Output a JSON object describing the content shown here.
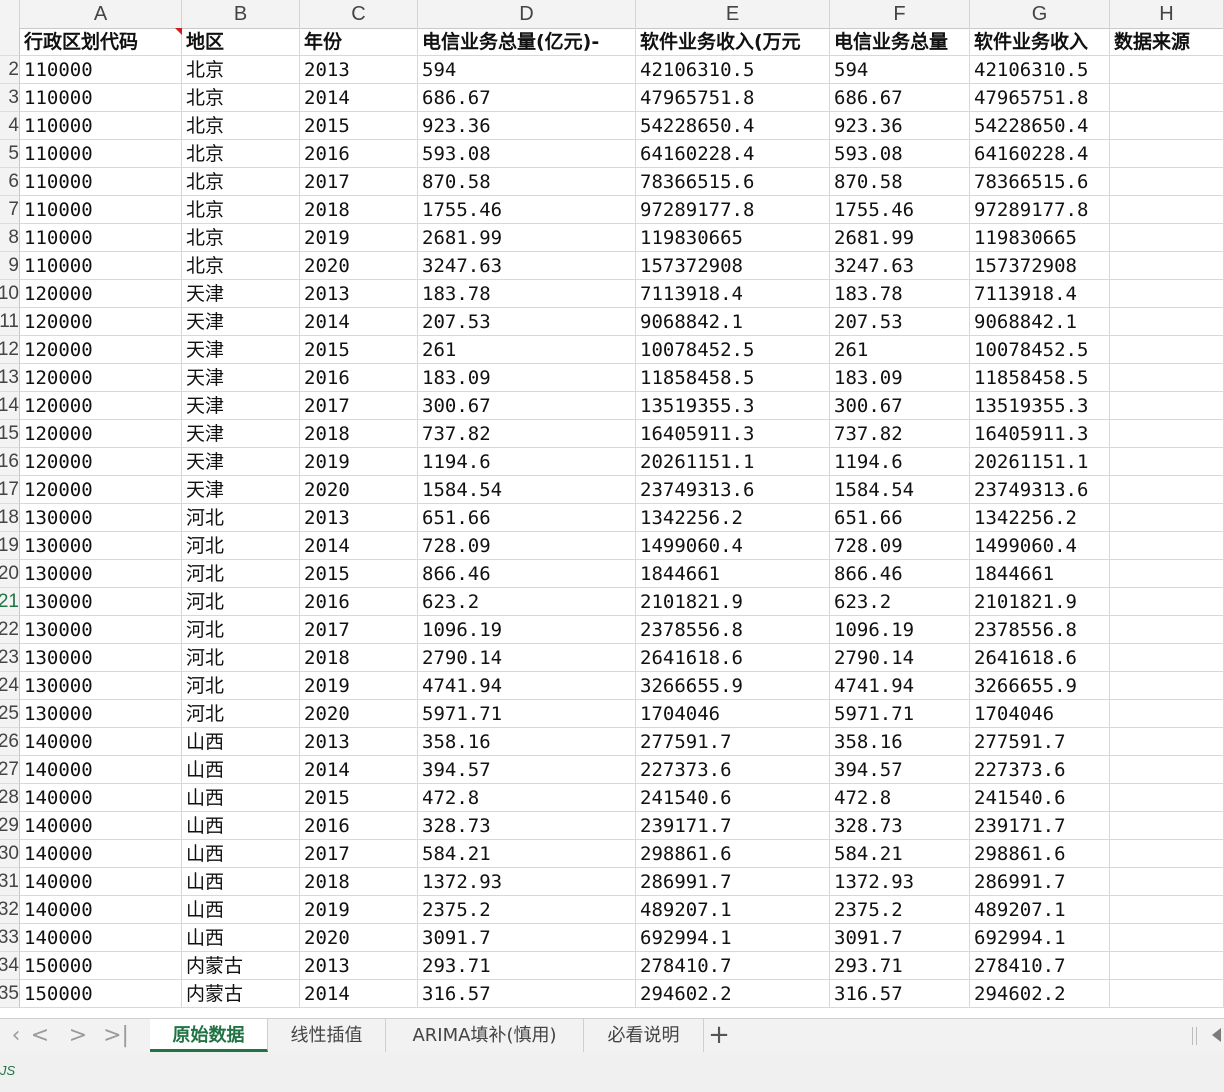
{
  "columns": [
    "A",
    "B",
    "C",
    "D",
    "E",
    "F",
    "G",
    "H"
  ],
  "header": [
    "行政区划代码",
    "地区",
    "年份",
    "电信业务总量(亿元)-",
    "软件业务收入(万元",
    "电信业务总量",
    "软件业务收入",
    "数据来源"
  ],
  "row_numbers": [
    "2",
    "3",
    "4",
    "5",
    "6",
    "7",
    "8",
    "9",
    "10",
    "11",
    "12",
    "13",
    "14",
    "15",
    "16",
    "17",
    "18",
    "19",
    "20",
    "21",
    "22",
    "23",
    "24",
    "25",
    "26",
    "27",
    "28",
    "29",
    "30",
    "31",
    "32",
    "33",
    "34",
    "35"
  ],
  "rows": [
    [
      "110000",
      "北京",
      "2013",
      "594",
      "42106310.5",
      "594",
      "42106310.5",
      ""
    ],
    [
      "110000",
      "北京",
      "2014",
      "686.67",
      "47965751.8",
      "686.67",
      "47965751.8",
      ""
    ],
    [
      "110000",
      "北京",
      "2015",
      "923.36",
      "54228650.4",
      "923.36",
      "54228650.4",
      ""
    ],
    [
      "110000",
      "北京",
      "2016",
      "593.08",
      "64160228.4",
      "593.08",
      "64160228.4",
      ""
    ],
    [
      "110000",
      "北京",
      "2017",
      "870.58",
      "78366515.6",
      "870.58",
      "78366515.6",
      ""
    ],
    [
      "110000",
      "北京",
      "2018",
      "1755.46",
      "97289177.8",
      "1755.46",
      "97289177.8",
      ""
    ],
    [
      "110000",
      "北京",
      "2019",
      "2681.99",
      "119830665",
      "2681.99",
      "119830665",
      ""
    ],
    [
      "110000",
      "北京",
      "2020",
      "3247.63",
      "157372908",
      "3247.63",
      "157372908",
      ""
    ],
    [
      "120000",
      "天津",
      "2013",
      "183.78",
      "7113918.4",
      "183.78",
      "7113918.4",
      ""
    ],
    [
      "120000",
      "天津",
      "2014",
      "207.53",
      "9068842.1",
      "207.53",
      "9068842.1",
      ""
    ],
    [
      "120000",
      "天津",
      "2015",
      "261",
      "10078452.5",
      "261",
      "10078452.5",
      ""
    ],
    [
      "120000",
      "天津",
      "2016",
      "183.09",
      "11858458.5",
      "183.09",
      "11858458.5",
      ""
    ],
    [
      "120000",
      "天津",
      "2017",
      "300.67",
      "13519355.3",
      "300.67",
      "13519355.3",
      ""
    ],
    [
      "120000",
      "天津",
      "2018",
      "737.82",
      "16405911.3",
      "737.82",
      "16405911.3",
      ""
    ],
    [
      "120000",
      "天津",
      "2019",
      "1194.6",
      "20261151.1",
      "1194.6",
      "20261151.1",
      ""
    ],
    [
      "120000",
      "天津",
      "2020",
      "1584.54",
      "23749313.6",
      "1584.54",
      "23749313.6",
      ""
    ],
    [
      "130000",
      "河北",
      "2013",
      "651.66",
      "1342256.2",
      "651.66",
      "1342256.2",
      ""
    ],
    [
      "130000",
      "河北",
      "2014",
      "728.09",
      "1499060.4",
      "728.09",
      "1499060.4",
      ""
    ],
    [
      "130000",
      "河北",
      "2015",
      "866.46",
      "1844661",
      "866.46",
      "1844661",
      ""
    ],
    [
      "130000",
      "河北",
      "2016",
      "623.2",
      "2101821.9",
      "623.2",
      "2101821.9",
      ""
    ],
    [
      "130000",
      "河北",
      "2017",
      "1096.19",
      "2378556.8",
      "1096.19",
      "2378556.8",
      ""
    ],
    [
      "130000",
      "河北",
      "2018",
      "2790.14",
      "2641618.6",
      "2790.14",
      "2641618.6",
      ""
    ],
    [
      "130000",
      "河北",
      "2019",
      "4741.94",
      "3266655.9",
      "4741.94",
      "3266655.9",
      ""
    ],
    [
      "130000",
      "河北",
      "2020",
      "5971.71",
      "1704046",
      "5971.71",
      "1704046",
      ""
    ],
    [
      "140000",
      "山西",
      "2013",
      "358.16",
      "277591.7",
      "358.16",
      "277591.7",
      ""
    ],
    [
      "140000",
      "山西",
      "2014",
      "394.57",
      "227373.6",
      "394.57",
      "227373.6",
      ""
    ],
    [
      "140000",
      "山西",
      "2015",
      "472.8",
      "241540.6",
      "472.8",
      "241540.6",
      ""
    ],
    [
      "140000",
      "山西",
      "2016",
      "328.73",
      "239171.7",
      "328.73",
      "239171.7",
      ""
    ],
    [
      "140000",
      "山西",
      "2017",
      "584.21",
      "298861.6",
      "584.21",
      "298861.6",
      ""
    ],
    [
      "140000",
      "山西",
      "2018",
      "1372.93",
      "286991.7",
      "1372.93",
      "286991.7",
      ""
    ],
    [
      "140000",
      "山西",
      "2019",
      "2375.2",
      "489207.1",
      "2375.2",
      "489207.1",
      ""
    ],
    [
      "140000",
      "山西",
      "2020",
      "3091.7",
      "692994.1",
      "3091.7",
      "692994.1",
      ""
    ],
    [
      "150000",
      "内蒙古",
      "2013",
      "293.71",
      "278410.7",
      "293.71",
      "278410.7",
      ""
    ],
    [
      "150000",
      "内蒙古",
      "2014",
      "316.57",
      "294602.2",
      "316.57",
      "294602.2",
      ""
    ]
  ],
  "tabs": [
    {
      "label": "原始数据",
      "active": true
    },
    {
      "label": "线性插值",
      "active": false
    },
    {
      "label": "ARIMA填补(慎用)",
      "active": false
    },
    {
      "label": "必看说明",
      "active": false
    }
  ],
  "tab_nav": {
    "first": "|<",
    "prev": "<",
    "next": ">",
    "last": ">|",
    "add": "+"
  },
  "status": {
    "app_badge": "JS"
  },
  "colors": {
    "accent": "#217346",
    "comment": "#d01c1c"
  }
}
